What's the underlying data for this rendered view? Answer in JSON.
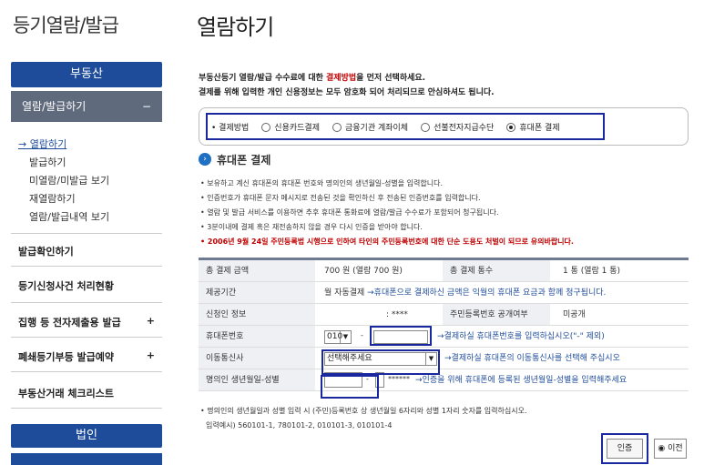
{
  "sidebar": {
    "title": "등기열람/발급",
    "header": "부동산",
    "active": "열람/발급하기",
    "active_toggle": "−",
    "subitems": [
      "→ 열람하기",
      "발급하기",
      "미열람/미발급 보기",
      "재열람하기",
      "열람/발급내역 보기"
    ],
    "items": [
      {
        "label": "발급확인하기",
        "toggle": ""
      },
      {
        "label": "등기신청사건 처리현황",
        "toggle": ""
      },
      {
        "label": "집행 등 전자제출용 발급",
        "toggle": "+"
      },
      {
        "label": "폐쇄등기부등 발급예약",
        "toggle": "+"
      },
      {
        "label": "부동산거래 체크리스트",
        "toggle": ""
      }
    ],
    "bottom_header": "법인"
  },
  "main": {
    "title": "열람하기",
    "intro_line1_a": "부동산등기 열람/발급 수수료에 대한 ",
    "intro_line1_b": "결제방법",
    "intro_line1_c": "을 먼저 선택하세요.",
    "intro_line2": "결제를 위해 입력한 개인 신용정보는 모두 암호화 되어 처리되므로 안심하셔도 됩니다.",
    "payment": {
      "label": "• 결제방법",
      "options": [
        "신용카드결제",
        "금융기관 계좌이체",
        "선불전자지급수단",
        "휴대폰 결제"
      ],
      "selected": 3
    },
    "section_title": "휴대폰 결제",
    "notes": [
      "• 보유하고 계신 휴대폰의 휴대폰 번호와 명의인의 생년월일-성별을 입력합니다.",
      "• 인증번호가 휴대폰 문자 메시지로 전송된 것을 확인하신 후 전송된 인증번호를 입력합니다.",
      "• 열람 및 발급 서비스를 이용하면 추후 휴대폰 통화료에 열람/발급 수수료가 포함되어 청구됩니다.",
      "• 3분이내에 결제 혹은 재전송하지 않을 경우 다시 인증을 받아야 합니다."
    ],
    "warning": "• 2006년 9월 24일 주민등록법 시행으로 인하여 타인의 주민등록번호에 대한 단순 도용도 처벌이 되므로 유의바랍니다.",
    "form": {
      "total_label": "총 결제 금액",
      "total_value": "700 원 (열람 700 원)",
      "count_label": "총 결제 통수",
      "count_value": "1 통 (열람 1 통)",
      "period_label": "제공기간",
      "period_value_a": "월 자동결제 ",
      "period_value_b": "→휴대폰으로 결제하신 금액은 익월의 휴대폰 요금과 함께 청구됩니다.",
      "applicant_label": "신청인 정보",
      "applicant_value": ": ****",
      "rrn_label": "주민등록번호 공개여부",
      "rrn_value": "미공개",
      "phone_label": "휴대폰번호",
      "phone_prefix": "010",
      "phone_dash": "-",
      "phone_hint": "→결제하실 휴대폰번호를 입력하십시오(\"-\" 제외)",
      "carrier_label": "이동통신사",
      "carrier_select": "선택해주세요",
      "carrier_hint": "→결제하실 휴대폰의 이동통신사를 선택해 주십시오",
      "birth_label": "명의인 생년월일-성별",
      "birth_dash": "-",
      "birth_mask": "******",
      "birth_hint": "→인증을 위해 휴대폰에 등록된 생년월일-성별을 입력해주세요"
    },
    "bottom_note1": "• 명의인의 생년월일과 성별 입력 시 (주민)등록번호 상 생년월일 6자리와 성별 1자리 숫자를 입력하십시오.",
    "bottom_note2": "입력예시) 560101-1, 780101-2, 010101-3, 010101-4",
    "auth_button": "인증",
    "prev_button": "이전",
    "prev_icon": "circle-arrow-icon"
  }
}
